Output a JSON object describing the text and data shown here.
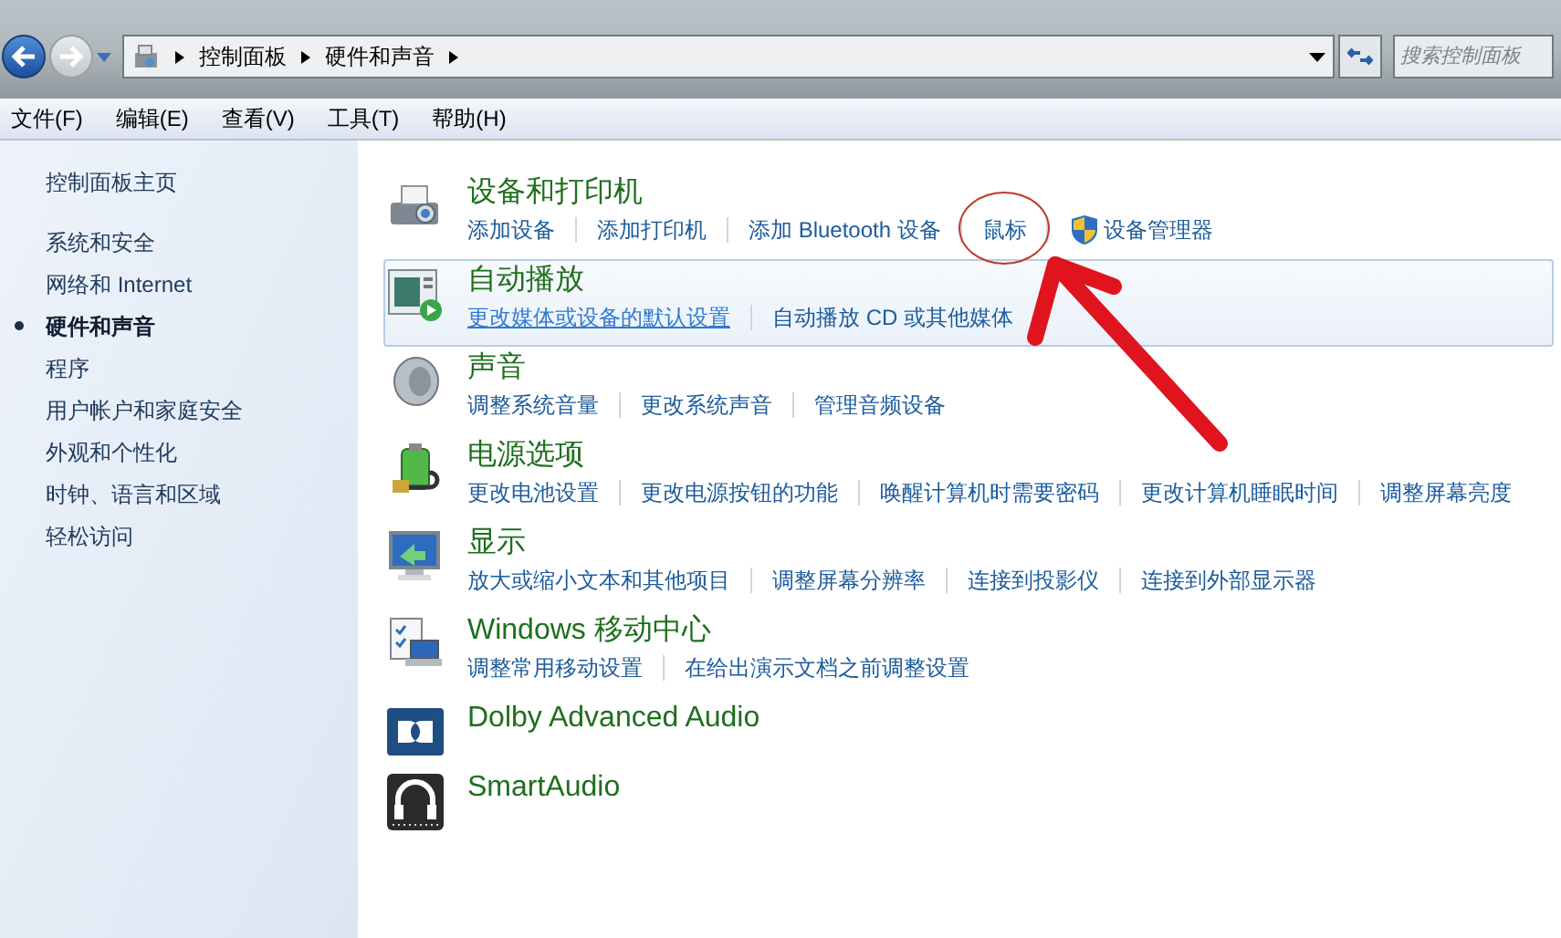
{
  "address_bar": {
    "crumbs": [
      "控制面板",
      "硬件和声音"
    ]
  },
  "search": {
    "placeholder": "搜索控制面板"
  },
  "menu": [
    "文件(F)",
    "编辑(E)",
    "查看(V)",
    "工具(T)",
    "帮助(H)"
  ],
  "sidebar": {
    "home": "控制面板主页",
    "items": [
      {
        "label": "系统和安全",
        "selected": false
      },
      {
        "label": "网络和 Internet",
        "selected": false
      },
      {
        "label": "硬件和声音",
        "selected": true
      },
      {
        "label": "程序",
        "selected": false
      },
      {
        "label": "用户帐户和家庭安全",
        "selected": false
      },
      {
        "label": "外观和个性化",
        "selected": false
      },
      {
        "label": "时钟、语言和区域",
        "selected": false
      },
      {
        "label": "轻松访问",
        "selected": false
      }
    ]
  },
  "categories": [
    {
      "kind": "printer",
      "title": "设备和打印机",
      "highlighted": false,
      "links": [
        {
          "label": "添加设备",
          "kind": "plain",
          "hovered": false
        },
        {
          "label": "添加打印机",
          "kind": "plain",
          "hovered": false
        },
        {
          "label": "添加 Bluetooth 设备",
          "kind": "plain",
          "hovered": false
        },
        {
          "label": "鼠标",
          "kind": "plain",
          "hovered": false,
          "circled": true
        },
        {
          "label": "设备管理器",
          "kind": "shield",
          "hovered": false
        }
      ]
    },
    {
      "kind": "autoplay",
      "title": "自动播放",
      "highlighted": true,
      "links": [
        {
          "label": "更改媒体或设备的默认设置",
          "kind": "plain",
          "hovered": true
        },
        {
          "label": "自动播放 CD 或其他媒体",
          "kind": "plain",
          "hovered": false
        }
      ]
    },
    {
      "kind": "speaker",
      "title": "声音",
      "highlighted": false,
      "links": [
        {
          "label": "调整系统音量",
          "kind": "plain",
          "hovered": false
        },
        {
          "label": "更改系统声音",
          "kind": "plain",
          "hovered": false
        },
        {
          "label": "管理音频设备",
          "kind": "plain",
          "hovered": false
        }
      ]
    },
    {
      "kind": "power",
      "title": "电源选项",
      "highlighted": false,
      "links": [
        {
          "label": "更改电池设置",
          "kind": "plain",
          "hovered": false
        },
        {
          "label": "更改电源按钮的功能",
          "kind": "plain",
          "hovered": false
        },
        {
          "label": "唤醒计算机时需要密码",
          "kind": "plain",
          "hovered": false
        },
        {
          "label": "更改计算机睡眠时间",
          "kind": "plain",
          "hovered": false
        },
        {
          "label": "调整屏幕亮度",
          "kind": "plain",
          "hovered": false
        }
      ]
    },
    {
      "kind": "display",
      "title": "显示",
      "highlighted": false,
      "links": [
        {
          "label": "放大或缩小文本和其他项目",
          "kind": "plain",
          "hovered": false
        },
        {
          "label": "调整屏幕分辨率",
          "kind": "plain",
          "hovered": false
        },
        {
          "label": "连接到投影仪",
          "kind": "plain",
          "hovered": false
        },
        {
          "label": "连接到外部显示器",
          "kind": "plain",
          "hovered": false
        }
      ]
    },
    {
      "kind": "mobility",
      "title": "Windows 移动中心",
      "highlighted": false,
      "links": [
        {
          "label": "调整常用移动设置",
          "kind": "plain",
          "hovered": false
        },
        {
          "label": "在给出演示文档之前调整设置",
          "kind": "plain",
          "hovered": false
        }
      ]
    },
    {
      "kind": "dolby",
      "title": "Dolby Advanced Audio",
      "highlighted": false
    },
    {
      "kind": "headphones",
      "title": "SmartAudio",
      "highlighted": false
    }
  ]
}
